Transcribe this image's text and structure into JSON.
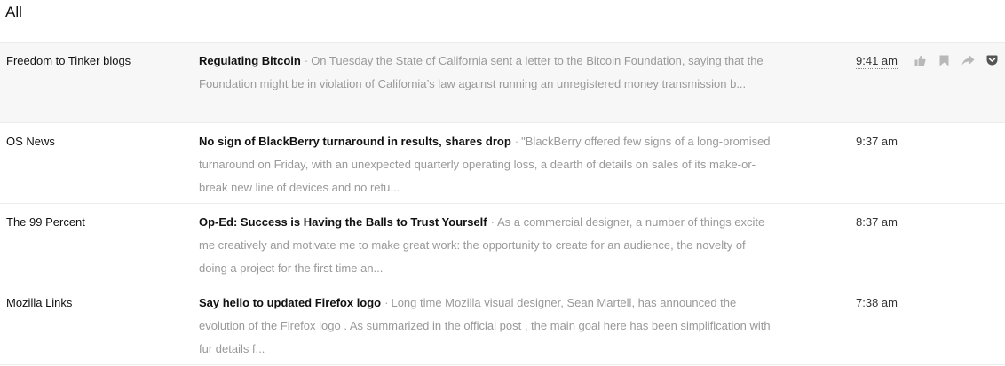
{
  "heading": "All",
  "entries": [
    {
      "source": "Freedom to Tinker blogs",
      "title": "Regulating Bitcoin",
      "separator": "·",
      "snippet": "On Tuesday the State of California sent a letter to the Bitcoin Foundation, saying that the Foundation might be in violation of California’s law against running an unregistered money transmission b...",
      "time": "9:41 am"
    },
    {
      "source": "OS News",
      "title": "No sign of BlackBerry turnaround in results, shares drop",
      "separator": "·",
      "snippet": "\"BlackBerry offered few signs of a long-promised turnaround on Friday, with an unexpected quarterly operating loss, a dearth of details on sales of its make-or-break new line of devices and no retu...",
      "time": "9:37 am"
    },
    {
      "source": "The 99 Percent",
      "title": "Op-Ed: Success is Having the Balls to Trust Yourself",
      "separator": "·",
      "snippet": "As a commercial designer, a number of things excite me creatively and motivate me to make great work: the opportunity to create for an audience, the novelty of doing a project for the first time an...",
      "time": "8:37 am"
    },
    {
      "source": "Mozilla Links",
      "title": "Say hello to updated Firefox logo",
      "separator": "·",
      "snippet": "Long time Mozilla visual designer, Sean Martell, has announced the evolution of the Firefox logo . As summarized in the official post , the main goal here has been simplification with fur details f...",
      "time": "7:38 am"
    }
  ],
  "row_actions": [
    "thumbs-up-icon",
    "bookmark-icon",
    "share-arrow-icon",
    "pocket-icon"
  ],
  "colors": {
    "selected_row_bg": "#f7f7f7",
    "snippet_text": "#999999",
    "icon_gray": "#b8b8b8",
    "pocket_dark": "#555555"
  }
}
